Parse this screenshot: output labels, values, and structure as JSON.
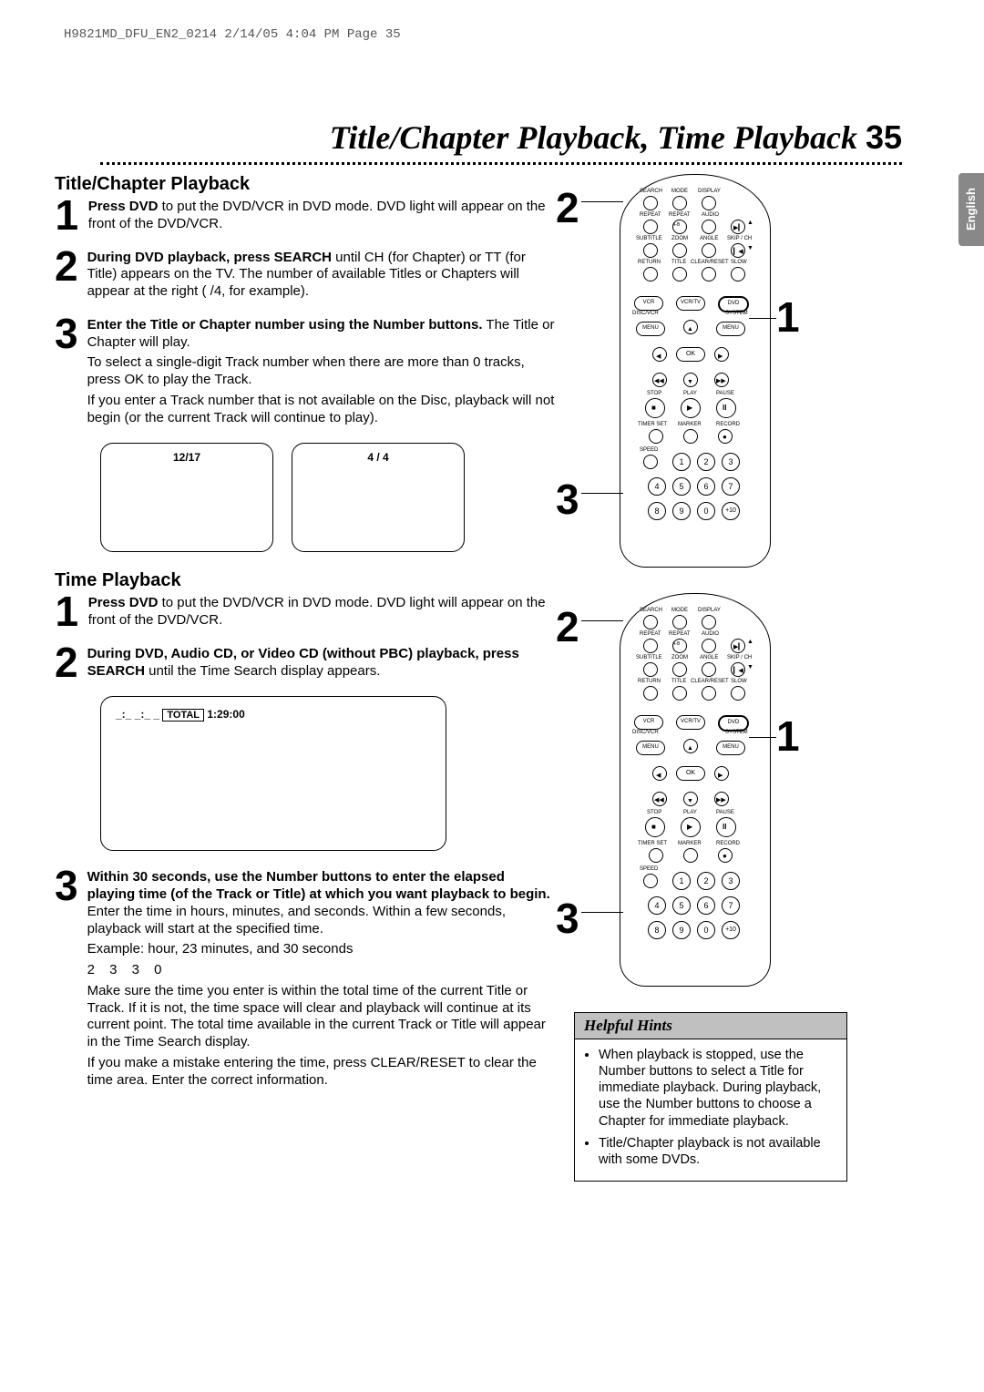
{
  "print_header": "H9821MD_DFU_EN2_0214  2/14/05  4:04 PM  Page 35",
  "page_title_text": "Title/Chapter Playback, Time Playback",
  "page_number": "35",
  "lang_tab": "English",
  "section1_title": "Title/Chapter Playback",
  "s1_step1_bold": "Press DVD",
  "s1_step1_rest": " to put the DVD/VCR in DVD mode. DVD light will appear on the front of the DVD/VCR.",
  "s1_step2_bold": "During DVD playback, press SEARCH",
  "s1_step2_rest": " until CH (for Chapter) or TT (for Title) appears on the TV. The number of available Titles or Chapters will appear at the right (  /4, for example).",
  "s1_step3_bold": "Enter the Title or Chapter number using the Number buttons.",
  "s1_step3_rest": " The Title or Chapter will play.",
  "s1_step3_note1": "To select a single-digit Track number when there are more than  0 tracks, press OK to play the Track.",
  "s1_step3_note2": "If you enter a Track number that is not available on the Disc, playback will not begin (or the current Track will continue to play).",
  "screen1_text": "12/17",
  "screen2_text": "4 / 4",
  "section2_title": "Time Playback",
  "s2_step1_bold": "Press DVD",
  "s2_step1_rest": " to put the DVD/VCR in DVD mode. DVD light will appear on the front of the DVD/VCR.",
  "s2_step2_bold": "During DVD, Audio CD, or Video CD (without PBC) playback, press SEARCH",
  "s2_step2_rest": " until the Time Search display appears.",
  "screen3_left": "_:_ _:_ _",
  "screen3_total_label": "TOTAL",
  "screen3_total_time": "1:29:00",
  "s2_step3_bold": "Within 30 seconds, use the Number buttons to enter the elapsed playing time (of the Track or Title) at which you want playback to begin.",
  "s2_step3_rest": " Enter the time in hours, minutes, and seconds. Within a few seconds, playback will start at the specified time.",
  "s2_step3_example": "Example:   hour, 23 minutes, and 30 seconds",
  "s2_step3_example_nums": "2     3     3     0",
  "s2_step3_note1": "Make sure the time you enter is within the total time of the current Title or Track. If it is not, the time space will clear and playback will continue at its current point. The total time available in the current Track or Title will appear in the Time Search display.",
  "s2_step3_note2": "If you make a mistake entering the time, press CLEAR/RESET to clear the time area. Enter the correct information.",
  "hints_title": "Helpful Hints",
  "hint1": "When playback is stopped, use the Number buttons to select a Title for immediate playback. During playback, use the Number buttons to choose a Chapter for immediate playback.",
  "hint2": "Title/Chapter playback is not available with some DVDs.",
  "remote_labels": {
    "search": "SEARCH",
    "mode": "MODE",
    "display": "DISPLAY",
    "repeat": "REPEAT",
    "ab": "A-B",
    "audio": "AUDIO",
    "subtitle": "SUBTITLE",
    "zoom": "ZOOM",
    "angle": "ANGLE",
    "skip": "SKIP / CH",
    "return": "RETURN",
    "title": "TITLE",
    "clear": "CLEAR/RESET",
    "slow": "SLOW",
    "vcr": "VCR",
    "vcrtv": "VCR/TV",
    "dvd": "DVD",
    "discvcr": "DISC/VCR",
    "system": "SYSTEM",
    "menu": "MENU",
    "ok": "OK",
    "stop": "STOP",
    "play": "PLAY",
    "pause": "PAUSE",
    "timer": "TIMER SET",
    "marker": "MARKER",
    "record": "RECORD",
    "speed": "SPEED",
    "plus10": "+10"
  },
  "step_nums": {
    "one": "1",
    "two": "2",
    "three": "3"
  },
  "callouts": {
    "c1": "1",
    "c2": "2",
    "c3": "3"
  }
}
